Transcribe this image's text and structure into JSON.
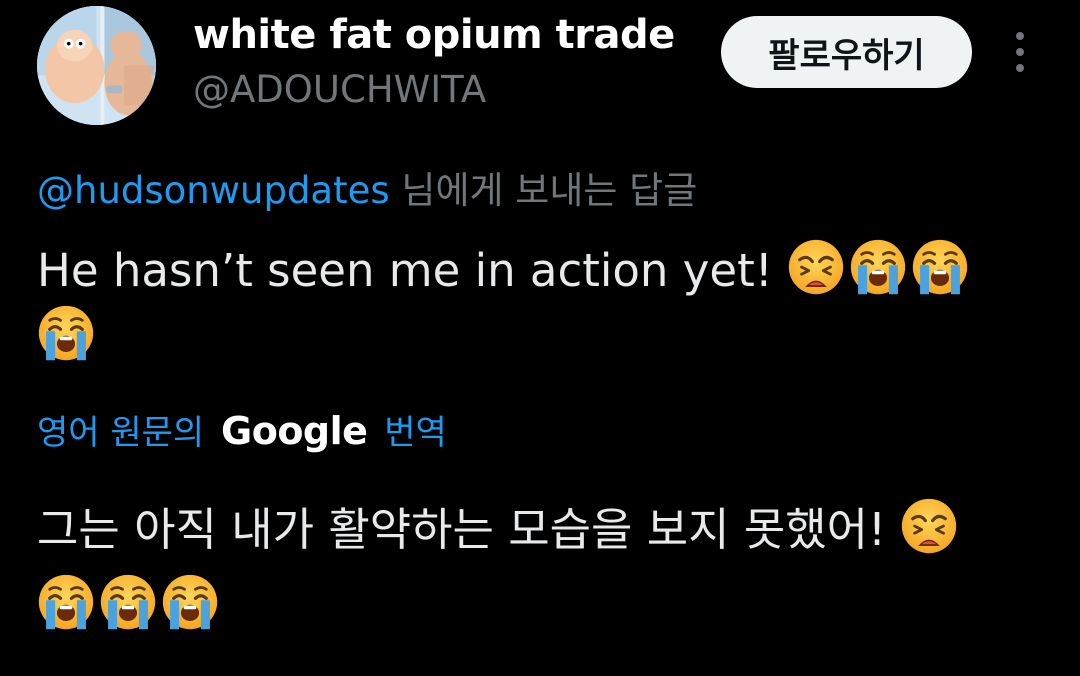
{
  "author": {
    "display_name": "white fat opium trade",
    "handle": "@ADOUCHWITA",
    "avatar_icon": "cartoon-character-avatar"
  },
  "header": {
    "follow_label": "팔로우하기",
    "more_icon": "more-vertical-icon"
  },
  "reply": {
    "mention": "@hudsonwupdates",
    "suffix": " 님에게 보내는 답글"
  },
  "tweet": {
    "text": "He hasn’t seen me in action yet! ",
    "emojis": [
      "weary-face-emoji",
      "loudly-crying-face-emoji",
      "loudly-crying-face-emoji",
      "loudly-crying-face-emoji"
    ]
  },
  "translation": {
    "prefix": "영어 원문의 ",
    "brand": "Google",
    "suffix": " 번역",
    "text": "그는 아직 내가 활약하는 모습을 보지 못했어! ",
    "emojis": [
      "weary-face-emoji",
      "loudly-crying-face-emoji",
      "loudly-crying-face-emoji",
      "loudly-crying-face-emoji"
    ]
  },
  "colors": {
    "background": "#000000",
    "primary_text": "#e7e9ea",
    "secondary_text": "#71767b",
    "link": "#1d9bf0",
    "follow_button_bg": "#eff3f4"
  }
}
